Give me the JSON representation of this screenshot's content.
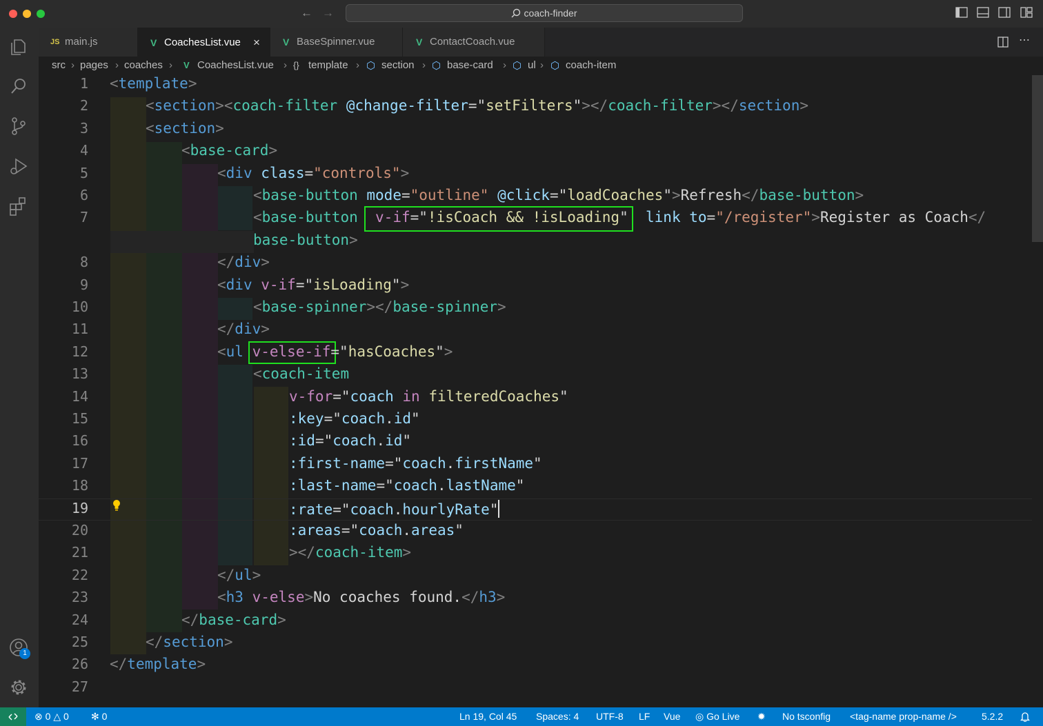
{
  "window": {
    "title": "coach-finder"
  },
  "tabs": [
    {
      "label": "main.js",
      "icon": "js-icon",
      "icon_text": "JS"
    },
    {
      "label": "CoachesList.vue",
      "icon": "vue-icon",
      "active": true
    },
    {
      "label": "BaseSpinner.vue",
      "icon": "vue-icon"
    },
    {
      "label": "ContactCoach.vue",
      "icon": "vue-icon"
    }
  ],
  "breadcrumb": [
    "src",
    "pages",
    "coaches",
    "CoachesList.vue",
    "template",
    "section",
    "base-card",
    "ul",
    "coach-item"
  ],
  "editor": {
    "line_numbers": [
      "1",
      "2",
      "3",
      "4",
      "5",
      "6",
      "7",
      "8",
      "9",
      "10",
      "11",
      "12",
      "13",
      "14",
      "15",
      "16",
      "17",
      "18",
      "19",
      "20",
      "21",
      "22",
      "23",
      "24",
      "25",
      "26",
      "27"
    ],
    "current_line": "19",
    "highlighted": [
      "v-if=\"!isCoach && !isLoading\"",
      "v-else-if"
    ],
    "code": {
      "l1": {
        "p1": "<",
        "tag": "template",
        "p2": ">"
      },
      "l2": {
        "p1": "<",
        "tag1": "section",
        "p2": "><",
        "tag2": "coach-filter",
        "attr": "@change-filter",
        "eq": "=\"",
        "val": "setFilters",
        "q": "\"",
        "p3": "></",
        "tag3": "coach-filter",
        "p4": "></",
        "tag4": "section",
        "p5": ">"
      },
      "l3": {
        "p1": "<",
        "tag": "section",
        "p2": ">"
      },
      "l4": {
        "p1": "<",
        "tag": "base-card",
        "p2": ">"
      },
      "l5": {
        "p1": "<",
        "tag": "div",
        "attr": "class",
        "eq": "=",
        "val": "\"controls\"",
        "p2": ">"
      },
      "l6": {
        "p1": "<",
        "tag": "base-button",
        "attr1": "mode",
        "eq1": "=",
        "val1": "\"outline\"",
        "attr2": "@click",
        "eq2": "=\"",
        "val2": "loadCoaches",
        "q": "\"",
        "p2": ">",
        "text": "Refresh",
        "p3": "</",
        "tag2": "base-button",
        "p4": ">"
      },
      "l7": {
        "p1": "<",
        "tag": "base-button",
        "attr1": "v-if",
        "eq1": "=\"",
        "val1": "!isCoach && !isLoading",
        "q1": "\"",
        "attr2": "link",
        "attr3": "to",
        "eq3": "=",
        "val3": "\"/register\"",
        "p2": ">",
        "text": "Register as Coach",
        "p3": "</"
      },
      "l7b": {
        "tag": "base-button",
        "p": ">"
      },
      "l8": {
        "p1": "</",
        "tag": "div",
        "p2": ">"
      },
      "l9": {
        "p1": "<",
        "tag": "div",
        "attr": "v-if",
        "eq": "=\"",
        "val": "isLoading",
        "q": "\"",
        "p2": ">"
      },
      "l10": {
        "p1": "<",
        "tag1": "base-spinner",
        "p2": "></",
        "tag2": "base-spinner",
        "p3": ">"
      },
      "l11": {
        "p1": "</",
        "tag": "div",
        "p2": ">"
      },
      "l12": {
        "p1": "<",
        "tag": "ul",
        "attr": "v-else-if",
        "eq": "=\"",
        "val": "hasCoaches",
        "q": "\"",
        "p2": ">"
      },
      "l13": {
        "p1": "<",
        "tag": "coach-item"
      },
      "l14": {
        "attr": "v-for",
        "eq": "=\"",
        "v1": "coach",
        "kw": "in",
        "v2": "filteredCoaches",
        "q": "\""
      },
      "l15": {
        "attr": ":key",
        "eq": "=\"",
        "v1": "coach",
        "dot": ".",
        "v2": "id",
        "q": "\""
      },
      "l16": {
        "attr": ":id",
        "eq": "=\"",
        "v1": "coach",
        "dot": ".",
        "v2": "id",
        "q": "\""
      },
      "l17": {
        "attr": ":first-name",
        "eq": "=\"",
        "v1": "coach",
        "dot": ".",
        "v2": "firstName",
        "q": "\""
      },
      "l18": {
        "attr": ":last-name",
        "eq": "=\"",
        "v1": "coach",
        "dot": ".",
        "v2": "lastName",
        "q": "\""
      },
      "l19": {
        "attr": ":rate",
        "eq": "=\"",
        "v1": "coach",
        "dot": ".",
        "v2": "hourlyRate",
        "q": "\""
      },
      "l20": {
        "attr": ":areas",
        "eq": "=\"",
        "v1": "coach",
        "dot": ".",
        "v2": "areas",
        "q": "\""
      },
      "l21": {
        "p1": "></",
        "tag": "coach-item",
        "p2": ">"
      },
      "l22": {
        "p1": "</",
        "tag": "ul",
        "p2": ">"
      },
      "l23": {
        "p1": "<",
        "tag": "h3",
        "attr": "v-else",
        "p2": ">",
        "text": "No coaches found.",
        "p3": "</",
        "tag2": "h3",
        "p4": ">"
      },
      "l24": {
        "p1": "</",
        "tag": "base-card",
        "p2": ">"
      },
      "l25": {
        "p1": "</",
        "tag": "section",
        "p2": ">"
      },
      "l26": {
        "p1": "</",
        "tag": "template",
        "p2": ">"
      }
    }
  },
  "status": {
    "errors": "0",
    "warnings": "0",
    "ports": "0",
    "position": "Ln 19, Col 45",
    "spaces": "Spaces: 4",
    "encoding": "UTF-8",
    "eol": "LF",
    "language": "Vue",
    "golive": "Go Live",
    "tsconfig": "No tsconfig",
    "tagname": "<tag-name prop-name />",
    "version": "5.2.2"
  },
  "accounts_badge": "1",
  "colors": {
    "accent": "#007acc",
    "highlight_box": "#1fe01f",
    "tag": "#569cd6",
    "component_tag": "#4ec9b0",
    "attribute": "#9cdcfe",
    "directive": "#c586c0",
    "string": "#ce9178"
  }
}
